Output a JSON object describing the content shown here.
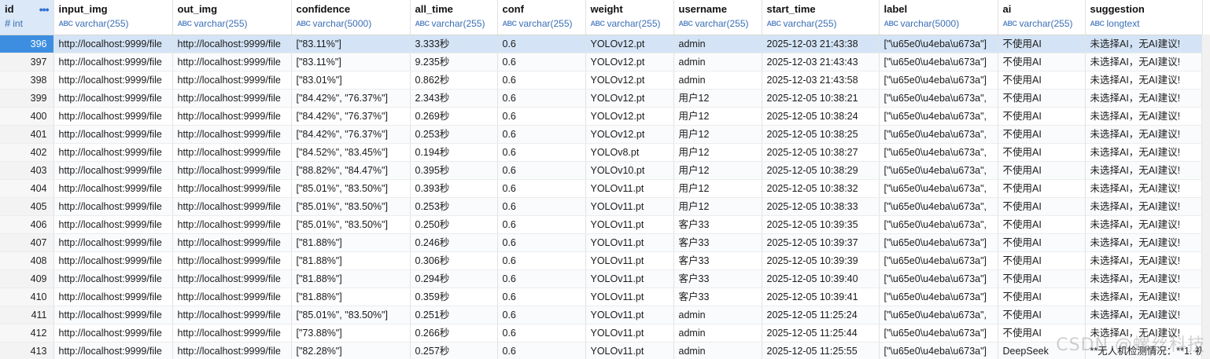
{
  "columns": [
    {
      "name": "id",
      "type": "int"
    },
    {
      "name": "input_img",
      "type": "varchar(255)"
    },
    {
      "name": "out_img",
      "type": "varchar(255)"
    },
    {
      "name": "confidence",
      "type": "varchar(5000)"
    },
    {
      "name": "all_time",
      "type": "varchar(255)"
    },
    {
      "name": "conf",
      "type": "varchar(255)"
    },
    {
      "name": "weight",
      "type": "varchar(255)"
    },
    {
      "name": "username",
      "type": "varchar(255)"
    },
    {
      "name": "start_time",
      "type": "varchar(255)"
    },
    {
      "name": "label",
      "type": "varchar(5000)"
    },
    {
      "name": "ai",
      "type": "varchar(255)"
    },
    {
      "name": "suggestion",
      "type": "longtext"
    }
  ],
  "type_icons": {
    "int": "#",
    "text": "ABC"
  },
  "selected_row_id": "396",
  "rows": [
    [
      "396",
      "http://localhost:9999/file",
      "http://localhost:9999/file",
      "[\"83.11%\"]",
      "3.333秒",
      "0.6",
      "YOLOv12.pt",
      "admin",
      "2025-12-03 21:43:38",
      "[\"\\u65e0\\u4eba\\u673a\"]",
      "不使用AI",
      "未选择AI，无AI建议!"
    ],
    [
      "397",
      "http://localhost:9999/file",
      "http://localhost:9999/file",
      "[\"83.11%\"]",
      "9.235秒",
      "0.6",
      "YOLOv12.pt",
      "admin",
      "2025-12-03 21:43:43",
      "[\"\\u65e0\\u4eba\\u673a\"]",
      "不使用AI",
      "未选择AI，无AI建议!"
    ],
    [
      "398",
      "http://localhost:9999/file",
      "http://localhost:9999/file",
      "[\"83.01%\"]",
      "0.862秒",
      "0.6",
      "YOLOv12.pt",
      "admin",
      "2025-12-03 21:43:58",
      "[\"\\u65e0\\u4eba\\u673a\"]",
      "不使用AI",
      "未选择AI，无AI建议!"
    ],
    [
      "399",
      "http://localhost:9999/file",
      "http://localhost:9999/file",
      "[\"84.42%\", \"76.37%\"]",
      "2.343秒",
      "0.6",
      "YOLOv12.pt",
      "用户12",
      "2025-12-05 10:38:21",
      "[\"\\u65e0\\u4eba\\u673a\",",
      "不使用AI",
      "未选择AI，无AI建议!"
    ],
    [
      "400",
      "http://localhost:9999/file",
      "http://localhost:9999/file",
      "[\"84.42%\", \"76.37%\"]",
      "0.269秒",
      "0.6",
      "YOLOv12.pt",
      "用户12",
      "2025-12-05 10:38:24",
      "[\"\\u65e0\\u4eba\\u673a\",",
      "不使用AI",
      "未选择AI，无AI建议!"
    ],
    [
      "401",
      "http://localhost:9999/file",
      "http://localhost:9999/file",
      "[\"84.42%\", \"76.37%\"]",
      "0.253秒",
      "0.6",
      "YOLOv12.pt",
      "用户12",
      "2025-12-05 10:38:25",
      "[\"\\u65e0\\u4eba\\u673a\",",
      "不使用AI",
      "未选择AI，无AI建议!"
    ],
    [
      "402",
      "http://localhost:9999/file",
      "http://localhost:9999/file",
      "[\"84.52%\", \"83.45%\"]",
      "0.194秒",
      "0.6",
      "YOLOv8.pt",
      "用户12",
      "2025-12-05 10:38:27",
      "[\"\\u65e0\\u4eba\\u673a\",",
      "不使用AI",
      "未选择AI，无AI建议!"
    ],
    [
      "403",
      "http://localhost:9999/file",
      "http://localhost:9999/file",
      "[\"88.82%\", \"84.47%\"]",
      "0.395秒",
      "0.6",
      "YOLOv10.pt",
      "用户12",
      "2025-12-05 10:38:29",
      "[\"\\u65e0\\u4eba\\u673a\",",
      "不使用AI",
      "未选择AI，无AI建议!"
    ],
    [
      "404",
      "http://localhost:9999/file",
      "http://localhost:9999/file",
      "[\"85.01%\", \"83.50%\"]",
      "0.393秒",
      "0.6",
      "YOLOv11.pt",
      "用户12",
      "2025-12-05 10:38:32",
      "[\"\\u65e0\\u4eba\\u673a\",",
      "不使用AI",
      "未选择AI，无AI建议!"
    ],
    [
      "405",
      "http://localhost:9999/file",
      "http://localhost:9999/file",
      "[\"85.01%\", \"83.50%\"]",
      "0.253秒",
      "0.6",
      "YOLOv11.pt",
      "用户12",
      "2025-12-05 10:38:33",
      "[\"\\u65e0\\u4eba\\u673a\",",
      "不使用AI",
      "未选择AI，无AI建议!"
    ],
    [
      "406",
      "http://localhost:9999/file",
      "http://localhost:9999/file",
      "[\"85.01%\", \"83.50%\"]",
      "0.250秒",
      "0.6",
      "YOLOv11.pt",
      "客户33",
      "2025-12-05 10:39:35",
      "[\"\\u65e0\\u4eba\\u673a\",",
      "不使用AI",
      "未选择AI，无AI建议!"
    ],
    [
      "407",
      "http://localhost:9999/file",
      "http://localhost:9999/file",
      "[\"81.88%\"]",
      "0.246秒",
      "0.6",
      "YOLOv11.pt",
      "客户33",
      "2025-12-05 10:39:37",
      "[\"\\u65e0\\u4eba\\u673a\"]",
      "不使用AI",
      "未选择AI，无AI建议!"
    ],
    [
      "408",
      "http://localhost:9999/file",
      "http://localhost:9999/file",
      "[\"81.88%\"]",
      "0.306秒",
      "0.6",
      "YOLOv11.pt",
      "客户33",
      "2025-12-05 10:39:39",
      "[\"\\u65e0\\u4eba\\u673a\"]",
      "不使用AI",
      "未选择AI，无AI建议!"
    ],
    [
      "409",
      "http://localhost:9999/file",
      "http://localhost:9999/file",
      "[\"81.88%\"]",
      "0.294秒",
      "0.6",
      "YOLOv11.pt",
      "客户33",
      "2025-12-05 10:39:40",
      "[\"\\u65e0\\u4eba\\u673a\"]",
      "不使用AI",
      "未选择AI，无AI建议!"
    ],
    [
      "410",
      "http://localhost:9999/file",
      "http://localhost:9999/file",
      "[\"81.88%\"]",
      "0.359秒",
      "0.6",
      "YOLOv11.pt",
      "客户33",
      "2025-12-05 10:39:41",
      "[\"\\u65e0\\u4eba\\u673a\"]",
      "不使用AI",
      "未选择AI，无AI建议!"
    ],
    [
      "411",
      "http://localhost:9999/file",
      "http://localhost:9999/file",
      "[\"85.01%\", \"83.50%\"]",
      "0.251秒",
      "0.6",
      "YOLOv11.pt",
      "admin",
      "2025-12-05 11:25:24",
      "[\"\\u65e0\\u4eba\\u673a\",",
      "不使用AI",
      "未选择AI，无AI建议!"
    ],
    [
      "412",
      "http://localhost:9999/file",
      "http://localhost:9999/file",
      "[\"73.88%\"]",
      "0.266秒",
      "0.6",
      "YOLOv11.pt",
      "admin",
      "2025-12-05 11:25:44",
      "[\"\\u65e0\\u4eba\\u673a\"]",
      "不使用AI",
      "未选择AI，无AI建议!"
    ],
    [
      "413",
      "http://localhost:9999/file",
      "http://localhost:9999/file",
      "[\"82.28%\"]",
      "0.257秒",
      "0.6",
      "YOLOv11.pt",
      "admin",
      "2025-12-05 11:25:55",
      "[\"\\u65e0\\u4eba\\u673a\"]",
      "DeepSeek",
      "**无人机检测情况：**1. 初"
    ]
  ],
  "watermark": "CSDN @螺丝科技"
}
